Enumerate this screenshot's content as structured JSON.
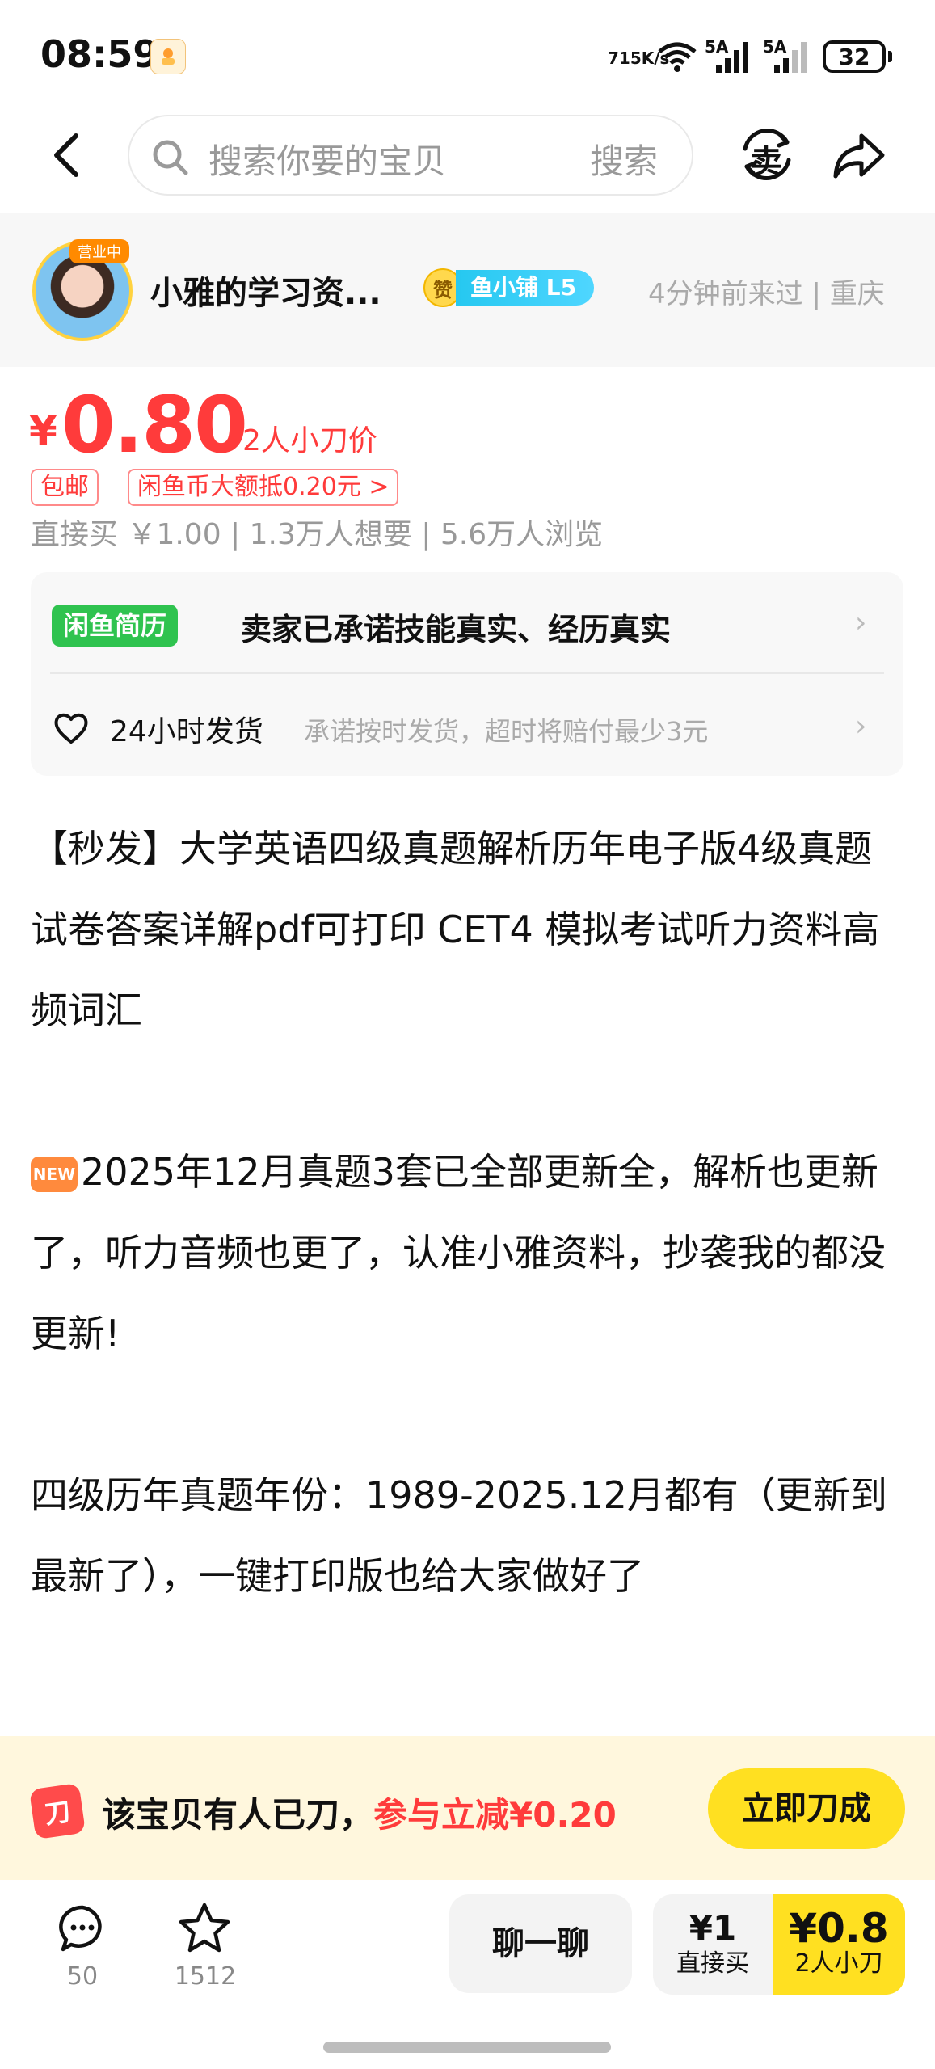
{
  "status_bar": {
    "time": "08:59",
    "net_speed_value": "715",
    "net_speed_unit": "K/s",
    "signal1_label": "5A",
    "signal2_label": "5A",
    "battery": "32"
  },
  "header": {
    "search_placeholder": "搜索你要的宝贝",
    "search_button": "搜索",
    "sell_icon_glyph": "卖"
  },
  "seller": {
    "avatar_badge": "营业中",
    "name": "小雅的学习资...",
    "level_zan": "赞",
    "level_label": "鱼小铺 L5",
    "meta": "4分钟前来过 | 重庆"
  },
  "price": {
    "symbol": "¥",
    "value": "0.80",
    "note": "2人小刀价",
    "tags": [
      "包邮",
      "闲鱼币大额抵0.20元 >"
    ],
    "stats": "直接买 ￥1.00 | 1.3万人想要 | 5.6万人浏览"
  },
  "promise": {
    "logo": "闲鱼简历",
    "text": "卖家已承诺技能真实、经历真实",
    "shipping_title": "24小时发货",
    "shipping_desc": "承诺按时发货，超时将赔付最少3元"
  },
  "description": {
    "para1": "【秒发】大学英语四级真题解析历年电子版4级真题试卷答案详解pdf可打印 CET4 模拟考试听力资料高频词汇",
    "new_tag": "NEW",
    "para2": "2025年12月真题3套已全部更新全，解析也更新了，听力音频也更了，认准小雅资料，抄袭我的都没更新!",
    "para3": "四级历年真题年份：1989-2025.12月都有（更新到最新了），一键打印版也给大家做好了"
  },
  "bargain_banner": {
    "icon_glyph": "刀",
    "text": "该宝贝有人已刀，",
    "highlight": "参与立减¥0.20",
    "button": "立即刀成"
  },
  "bottom_bar": {
    "comment_count": "50",
    "favorite_count": "1512",
    "chat_button": "聊一聊",
    "direct_price": "¥1",
    "direct_label": "直接买",
    "bargain_price": "¥0.8",
    "bargain_label": "2人小刀"
  },
  "colors": {
    "price_red": "#ff3b3b",
    "accent_yellow": "#ffe021",
    "xianyu_green": "#2fc34f",
    "level_cyan": "#26c8f0"
  }
}
